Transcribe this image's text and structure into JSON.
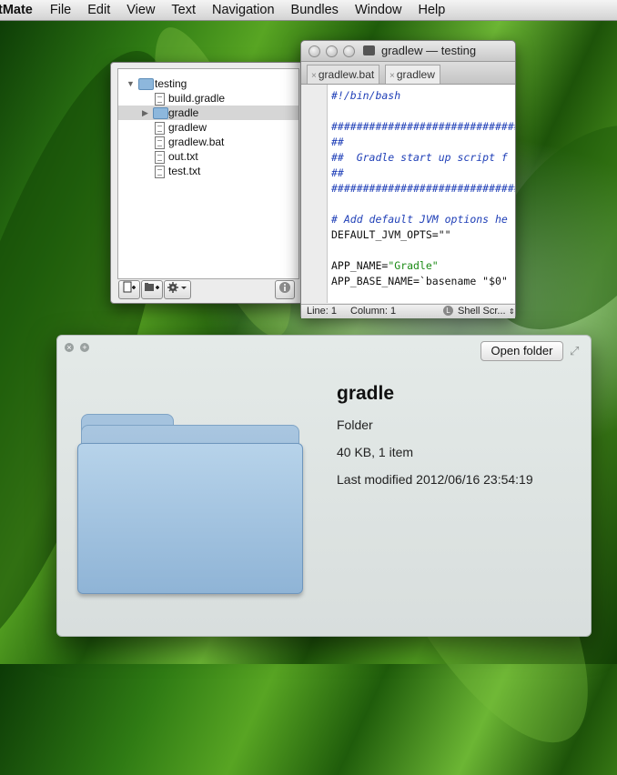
{
  "menubar": {
    "app": "tMate",
    "items": [
      "File",
      "Edit",
      "View",
      "Text",
      "Navigation",
      "Bundles",
      "Window",
      "Help"
    ]
  },
  "drawer": {
    "items": [
      {
        "label": "testing",
        "kind": "folder",
        "expanded": true
      },
      {
        "label": "build.gradle",
        "kind": "file"
      },
      {
        "label": "gradle",
        "kind": "folder",
        "expanded": false,
        "selected": true
      },
      {
        "label": "gradlew",
        "kind": "file"
      },
      {
        "label": "gradlew.bat",
        "kind": "file"
      },
      {
        "label": "out.txt",
        "kind": "file"
      },
      {
        "label": "test.txt",
        "kind": "file"
      }
    ],
    "buttons": [
      "new-file-icon",
      "new-folder-icon",
      "gear-icon",
      "info-icon"
    ]
  },
  "editor": {
    "title": "gradlew — testing",
    "tabs": [
      {
        "label": "gradlew.bat",
        "close": "×"
      },
      {
        "label": "gradlew",
        "close": "×",
        "active": true
      }
    ],
    "code": [
      {
        "text": "#!/bin/bash",
        "style": "com"
      },
      {
        "text": "",
        "style": "pl"
      },
      {
        "text": "##############################",
        "style": "com"
      },
      {
        "text": "##",
        "style": "com"
      },
      {
        "text": "##  Gradle start up script f",
        "style": "com"
      },
      {
        "text": "##",
        "style": "com"
      },
      {
        "text": "##############################",
        "style": "com"
      },
      {
        "text": "",
        "style": "pl"
      },
      {
        "text": "# Add default JVM options he",
        "style": "com"
      },
      {
        "text": "DEFAULT_JVM_OPTS=\"\"",
        "style": "pl"
      },
      {
        "text": "",
        "style": "pl"
      },
      {
        "text": "APP_NAME=\"Gradle\"",
        "style": "mix1"
      },
      {
        "text": "APP_BASE_NAME=`basename \"$0\"",
        "style": "mix2"
      }
    ],
    "status": {
      "line": "Line: 1",
      "column": "Column: 1",
      "language": "Shell Scr..."
    }
  },
  "quicklook": {
    "close": "×",
    "fullscreen": "+",
    "open_button": "Open folder",
    "name": "gradle",
    "kind": "Folder",
    "size": "40 KB, 1 item",
    "modified": "Last modified 2012/06/16 23:54:19"
  },
  "colors": {
    "comment": "#1f3fb7",
    "string": "#1c8b16",
    "folder": "#8db7dc"
  }
}
